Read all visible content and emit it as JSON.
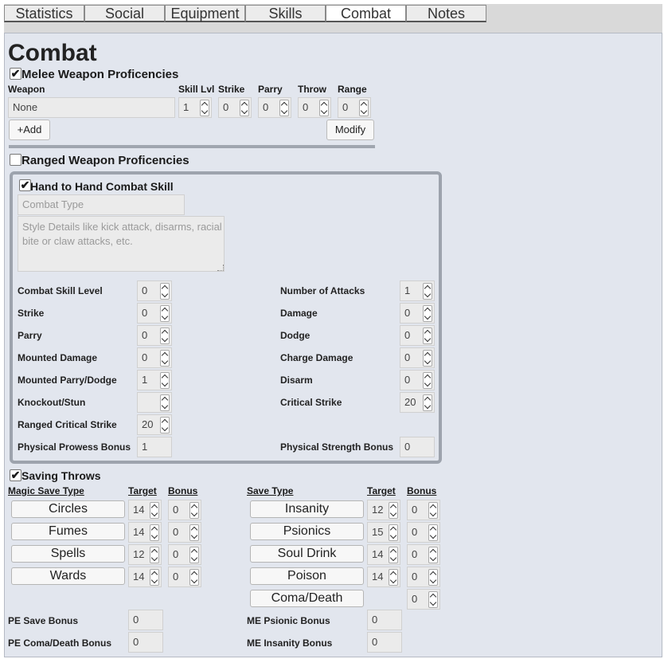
{
  "tabs": [
    "Statistics",
    "Social",
    "Equipment",
    "Skills",
    "Combat",
    "Notes"
  ],
  "title": "Combat",
  "melee": {
    "title": "Melee Weapon Proficencies",
    "checked": true,
    "headers": {
      "weapon": "Weapon",
      "skill": "Skill Lvl",
      "strike": "Strike",
      "parry": "Parry",
      "throw": "Throw",
      "range": "Range"
    },
    "row": {
      "weapon": "None",
      "skill": "1",
      "strike": "0",
      "parry": "0",
      "throw": "0",
      "range": "0"
    },
    "add": "+Add",
    "modify": "Modify"
  },
  "ranged": {
    "title": "Ranged Weapon Proficencies",
    "checked": false
  },
  "hth": {
    "title": "Hand to Hand Combat Skill",
    "checked": true,
    "type_placeholder": "Combat Type",
    "details_placeholder": "Style Details like kick attack, disarms, racial bite or claw attacks, etc.",
    "left": [
      {
        "label": "Combat Skill Level",
        "value": "0"
      },
      {
        "label": "Strike",
        "value": "0"
      },
      {
        "label": "Parry",
        "value": "0"
      },
      {
        "label": "Mounted Damage",
        "value": "0"
      },
      {
        "label": "Mounted Parry/Dodge",
        "value": "1"
      },
      {
        "label": "Knockout/Stun",
        "value": ""
      },
      {
        "label": "Ranged Critical Strike",
        "value": "20"
      },
      {
        "label": "Physical Prowess Bonus",
        "value": "1"
      }
    ],
    "right": [
      {
        "label": "Number of Attacks",
        "value": "1"
      },
      {
        "label": "Damage",
        "value": "0"
      },
      {
        "label": "Dodge",
        "value": "0"
      },
      {
        "label": "Charge Damage",
        "value": "0"
      },
      {
        "label": "Disarm",
        "value": "0"
      },
      {
        "label": "Critical Strike",
        "value": "20"
      },
      {
        "label": "Physical Strength Bonus",
        "value": "0"
      }
    ]
  },
  "saves": {
    "title": "Saving Throws",
    "checked": true,
    "left_headers": {
      "type": "Magic Save Type",
      "target": "Target",
      "bonus": "Bonus"
    },
    "right_headers": {
      "type": "Save Type",
      "target": "Target",
      "bonus": "Bonus"
    },
    "left": [
      {
        "name": "Circles",
        "target": "14",
        "bonus": "0"
      },
      {
        "name": "Fumes",
        "target": "14",
        "bonus": "0"
      },
      {
        "name": "Spells",
        "target": "12",
        "bonus": "0"
      },
      {
        "name": "Wards",
        "target": "14",
        "bonus": "0"
      }
    ],
    "right": [
      {
        "name": "Insanity",
        "target": "12",
        "bonus": "0"
      },
      {
        "name": "Psionics",
        "target": "15",
        "bonus": "0"
      },
      {
        "name": "Soul Drink",
        "target": "14",
        "bonus": "0"
      },
      {
        "name": "Poison",
        "target": "14",
        "bonus": "0"
      },
      {
        "name": "Coma/Death",
        "target": "",
        "bonus": "0"
      }
    ],
    "bonuses_left": [
      {
        "label": "PE Save Bonus",
        "value": "0"
      },
      {
        "label": "PE Coma/Death Bonus",
        "value": "0"
      }
    ],
    "bonuses_right": [
      {
        "label": "ME Psionic Bonus",
        "value": "0"
      },
      {
        "label": "ME Insanity Bonus",
        "value": "0"
      }
    ]
  }
}
